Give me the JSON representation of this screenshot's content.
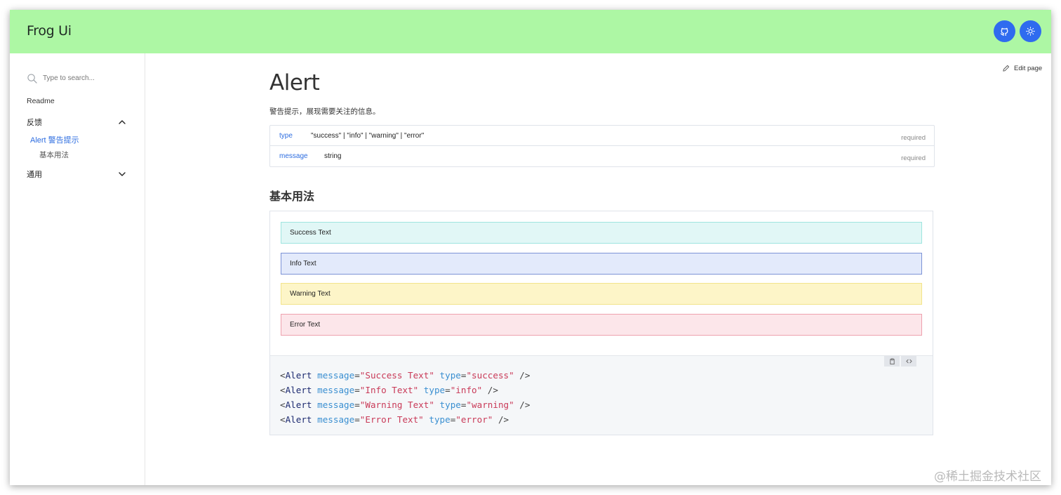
{
  "header": {
    "brand": "Frog Ui",
    "buttons": [
      {
        "name": "github",
        "icon": "github-icon"
      },
      {
        "name": "theme",
        "icon": "sun-icon"
      }
    ],
    "background": "#adf7a4",
    "button_color": "#2f6bef"
  },
  "sidebar": {
    "search_placeholder": "Type to search...",
    "readme": "Readme",
    "groups": [
      {
        "label": "反馈",
        "expanded": true,
        "items": [
          {
            "label": "Alert 警告提示",
            "active": true,
            "subitems": [
              {
                "label": "基本用法"
              }
            ]
          }
        ]
      },
      {
        "label": "通用",
        "expanded": false
      }
    ],
    "active_color": "#2d6de0"
  },
  "page": {
    "edit_label": "Edit page",
    "title": "Alert",
    "description": "警告提示，展现需要关注的信息。",
    "props": [
      {
        "name": "type",
        "type": "\"success\" | \"info\" | \"warning\" | \"error\"",
        "required": "required"
      },
      {
        "name": "message",
        "type": "string",
        "required": "required"
      }
    ],
    "section_title": "基本用法",
    "alerts": [
      {
        "kind": "success",
        "text": "Success Text"
      },
      {
        "kind": "info",
        "text": "Info Text"
      },
      {
        "kind": "warning",
        "text": "Warning Text"
      },
      {
        "kind": "error",
        "text": "Error Text"
      }
    ],
    "code_lines": [
      [
        "<",
        "Alert",
        " ",
        "message",
        "=",
        "\"Success Text\"",
        " ",
        "type",
        "=",
        "\"success\"",
        " />"
      ],
      [
        "<",
        "Alert",
        " ",
        "message",
        "=",
        "\"Info Text\"",
        " ",
        "type",
        "=",
        "\"info\"",
        " />"
      ],
      [
        "<",
        "Alert",
        " ",
        "message",
        "=",
        "\"Warning Text\"",
        " ",
        "type",
        "=",
        "\"warning\"",
        " />"
      ],
      [
        "<",
        "Alert",
        " ",
        "message",
        "=",
        "\"Error Text\"",
        " ",
        "type",
        "=",
        "\"error\"",
        " />"
      ]
    ]
  },
  "watermark": "@稀土掘金技术社区"
}
